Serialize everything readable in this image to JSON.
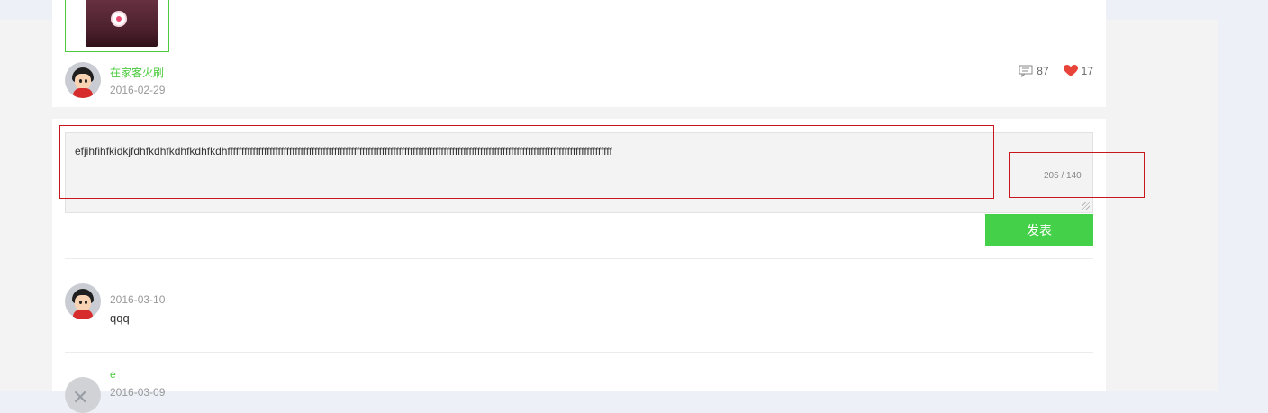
{
  "post": {
    "author": "在家客火刷",
    "date": "2016-02-29",
    "comment_count": "87",
    "like_count": "17",
    "icons": {
      "comment": "comment-icon",
      "like": "heart-icon"
    },
    "like_color": "#e8443a"
  },
  "editor": {
    "value": "efjihfihfkidkjfdhfkdhfkdhfkdhfkdhfffffffffffffffffffffffffffffffffffffffffffffffffffffffffffffffffffffffffffffffffffffffffffffffffffffffffffffffffffffffffffffffffffffffff",
    "counter": "205 / 140",
    "submit_label": "发表"
  },
  "comments": [
    {
      "user": "",
      "date": "2016-03-10",
      "text": "qqq"
    },
    {
      "user": "e",
      "date": "2016-03-09",
      "text": ""
    }
  ],
  "colors": {
    "accent": "#44d048",
    "link": "#4ccb3e",
    "annotation": "#c8161d"
  }
}
